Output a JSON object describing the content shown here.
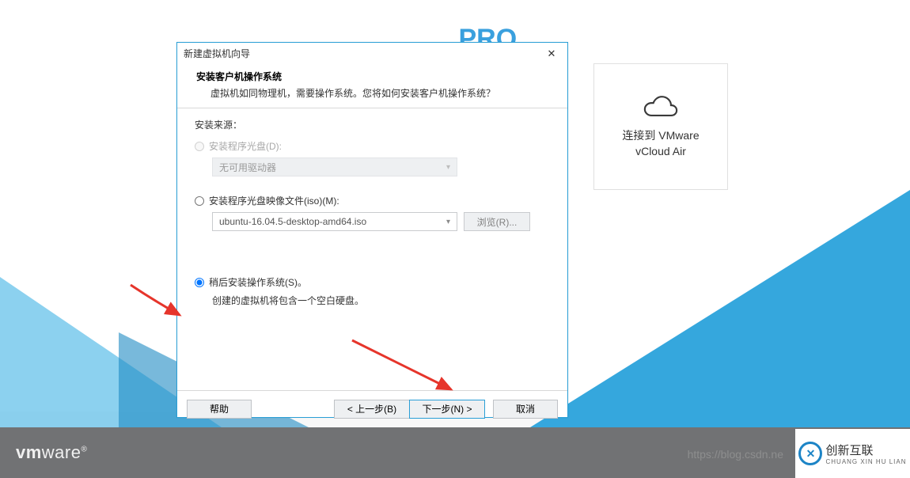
{
  "topfrag": {
    "pro": "PRO"
  },
  "tile": {
    "line1": "连接到 VMware",
    "line2": "vCloud Air"
  },
  "dialog": {
    "title": "新建虚拟机向导",
    "header_title": "安装客户机操作系统",
    "header_sub": "虚拟机如同物理机，需要操作系统。您将如何安装客户机操作系统？",
    "source_label": "安装来源：",
    "radio_cd": "安装程序光盘(D):",
    "drive_placeholder": "无可用驱动器",
    "radio_iso": "安装程序光盘映像文件(iso)(M):",
    "iso_value": "ubuntu-16.04.5-desktop-amd64.iso",
    "browse": "浏览(R)...",
    "radio_later": "稍后安装操作系统(S)。",
    "later_hint": "创建的虚拟机将包含一个空白硬盘。",
    "help": "帮助",
    "prev": "< 上一步(B)",
    "next": "下一步(N) >",
    "cancel": "取消"
  },
  "footer": {
    "vmware_pre": "vm",
    "vmware_post": "ware",
    "watermark": "https://blog.csdn.ne",
    "corner_brand": "创新互联",
    "corner_sub": "CHUANG XIN HU LIAN"
  }
}
